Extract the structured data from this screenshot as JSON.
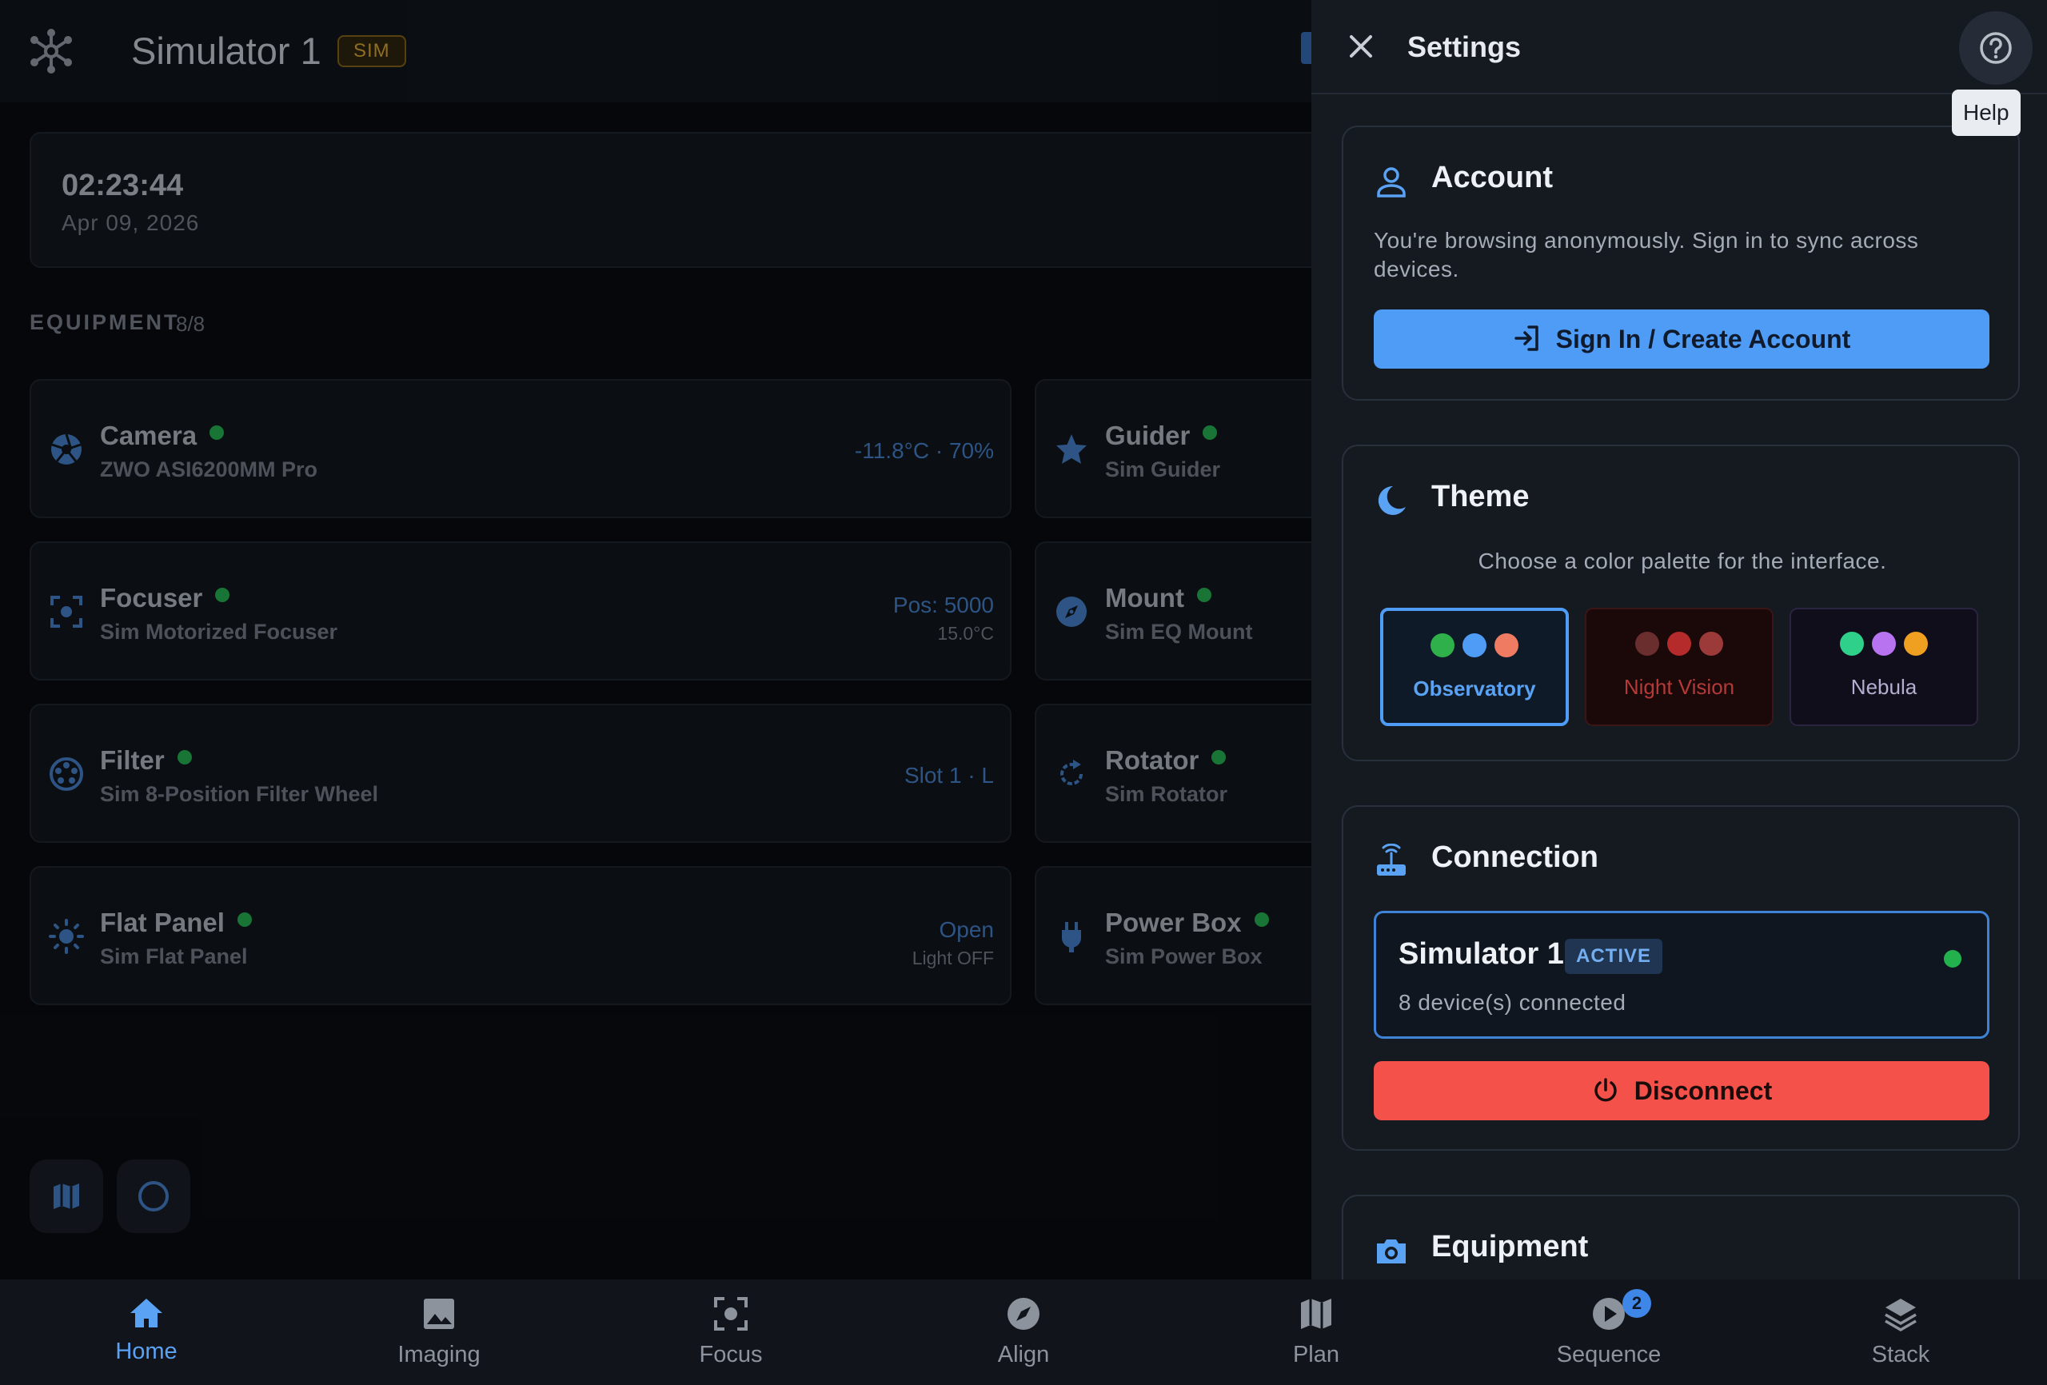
{
  "header": {
    "title": "Simulator 1",
    "badge": "SIM"
  },
  "clock": {
    "time": "02:23:44",
    "date": "Apr 09, 2026"
  },
  "equipment": {
    "title": "EQUIPMENT",
    "count": "8/8",
    "items": [
      {
        "name": "Camera",
        "model": "ZWO ASI6200MM Pro",
        "value": "-11.8°C · 70%",
        "icon": "aperture-icon"
      },
      {
        "name": "Guider",
        "model": "Sim Guider",
        "icon": "star-icon"
      },
      {
        "name": "Focuser",
        "model": "Sim Motorized Focuser",
        "value": "Pos: 5000",
        "sub": "15.0°C",
        "icon": "focus-icon"
      },
      {
        "name": "Mount",
        "model": "Sim EQ Mount",
        "icon": "compass-icon"
      },
      {
        "name": "Filter",
        "model": "Sim 8-Position Filter Wheel",
        "value": "Slot 1 · L",
        "icon": "filter-wheel-icon"
      },
      {
        "name": "Rotator",
        "model": "Sim Rotator",
        "icon": "rotate-icon"
      },
      {
        "name": "Flat Panel",
        "model": "Sim Flat Panel",
        "value": "Open",
        "sub": "Light OFF",
        "icon": "sun-icon"
      },
      {
        "name": "Power Box",
        "model": "Sim Power Box",
        "icon": "plug-icon"
      }
    ]
  },
  "settings": {
    "title": "Settings",
    "help_tooltip": "Help",
    "account": {
      "title": "Account",
      "text": "You're browsing anonymously. Sign in to sync across devices.",
      "button": "Sign In / Create Account"
    },
    "theme": {
      "title": "Theme",
      "description": "Choose a color palette for the interface.",
      "options": [
        {
          "label": "Observatory",
          "selected": true,
          "colors": [
            "#2fb04a",
            "#4f9cf7",
            "#f07b63"
          ]
        },
        {
          "label": "Night Vision",
          "selected": false,
          "colors": [
            "#6b2e2e",
            "#b52a2a",
            "#9c3a3a"
          ]
        },
        {
          "label": "Nebula",
          "selected": false,
          "colors": [
            "#2fd08a",
            "#b874f0",
            "#f0a020"
          ]
        }
      ]
    },
    "connection": {
      "title": "Connection",
      "name": "Simulator 1",
      "status": "ACTIVE",
      "devices": "8 device(s) connected",
      "button": "Disconnect"
    },
    "equipment_section": {
      "title": "Equipment"
    }
  },
  "nav": {
    "items": [
      {
        "label": "Home",
        "icon": "home-icon",
        "active": true
      },
      {
        "label": "Imaging",
        "icon": "image-icon"
      },
      {
        "label": "Focus",
        "icon": "focus-icon"
      },
      {
        "label": "Align",
        "icon": "compass-icon"
      },
      {
        "label": "Plan",
        "icon": "map-icon"
      },
      {
        "label": "Sequence",
        "icon": "play-circle-icon",
        "badge": "2"
      },
      {
        "label": "Stack",
        "icon": "layers-icon"
      }
    ]
  },
  "colors": {
    "accent": "#4f9cf7",
    "danger": "#f4514a",
    "status_ok": "#22b14c"
  }
}
